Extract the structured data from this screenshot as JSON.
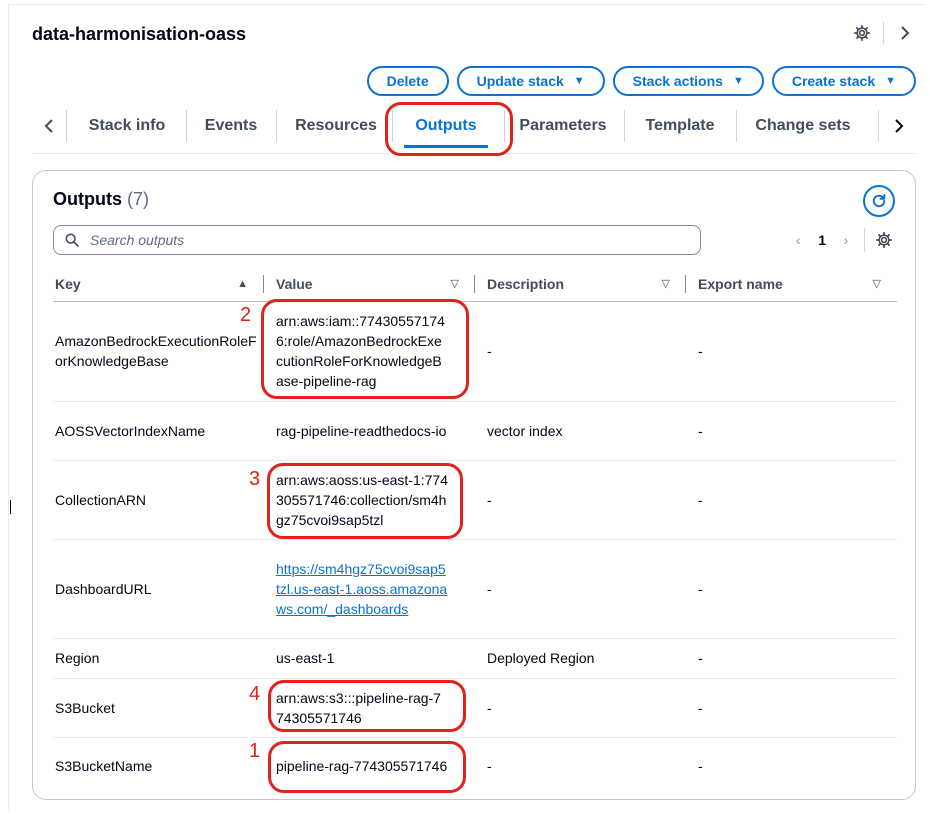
{
  "stack": {
    "title": "data-harmonisation-oass"
  },
  "actions": {
    "delete": "Delete",
    "update_stack": "Update stack",
    "stack_actions": "Stack actions",
    "create_stack": "Create stack"
  },
  "tabs": [
    {
      "label": "Stack info"
    },
    {
      "label": "Events"
    },
    {
      "label": "Resources"
    },
    {
      "label": "Outputs",
      "active": true
    },
    {
      "label": "Parameters"
    },
    {
      "label": "Template"
    },
    {
      "label": "Change sets"
    }
  ],
  "outputs_panel": {
    "title": "Outputs",
    "count": "(7)",
    "search_placeholder": "Search outputs",
    "page": "1",
    "columns": {
      "key": "Key",
      "value": "Value",
      "description": "Description",
      "export_name": "Export name"
    },
    "rows": [
      {
        "key": "AmazonBedrockExecutionRoleForKnowledgeBase",
        "value": "arn:aws:iam::774305571746:role/AmazonBedrockExecutionRoleForKnowledgeBase-pipeline-rag",
        "description": "-",
        "export": "-"
      },
      {
        "key": "AOSSVectorIndexName",
        "value": "rag-pipeline-readthedocs-io",
        "description": "vector index",
        "export": "-"
      },
      {
        "key": "CollectionARN",
        "value": "arn:aws:aoss:us-east-1:774305571746:collection/sm4hgz75cvoi9sap5tzl",
        "description": "-",
        "export": "-"
      },
      {
        "key": "DashboardURL",
        "value": "https://sm4hgz75cvoi9sap5tzl.us-east-1.aoss.amazonaws.com/_dashboards",
        "description": "-",
        "export": "-"
      },
      {
        "key": "Region",
        "value": "us-east-1",
        "description": "Deployed Region",
        "export": "-"
      },
      {
        "key": "S3Bucket",
        "value": "arn:aws:s3:::pipeline-rag-774305571746",
        "description": "-",
        "export": "-"
      },
      {
        "key": "S3BucketName",
        "value": "pipeline-rag-774305571746",
        "description": "-",
        "export": "-"
      }
    ]
  },
  "annotations": {
    "n1": "1",
    "n2": "2",
    "n3": "3",
    "n4": "4"
  },
  "colors": {
    "accent": "#0972d3",
    "highlight": "#e0231a"
  },
  "icons": [
    "settings-icon",
    "chevron-right-icon",
    "chevron-left-icon",
    "caret-down-icon",
    "refresh-icon",
    "search-icon",
    "sort-asc-icon",
    "sort-desc-icon"
  ]
}
